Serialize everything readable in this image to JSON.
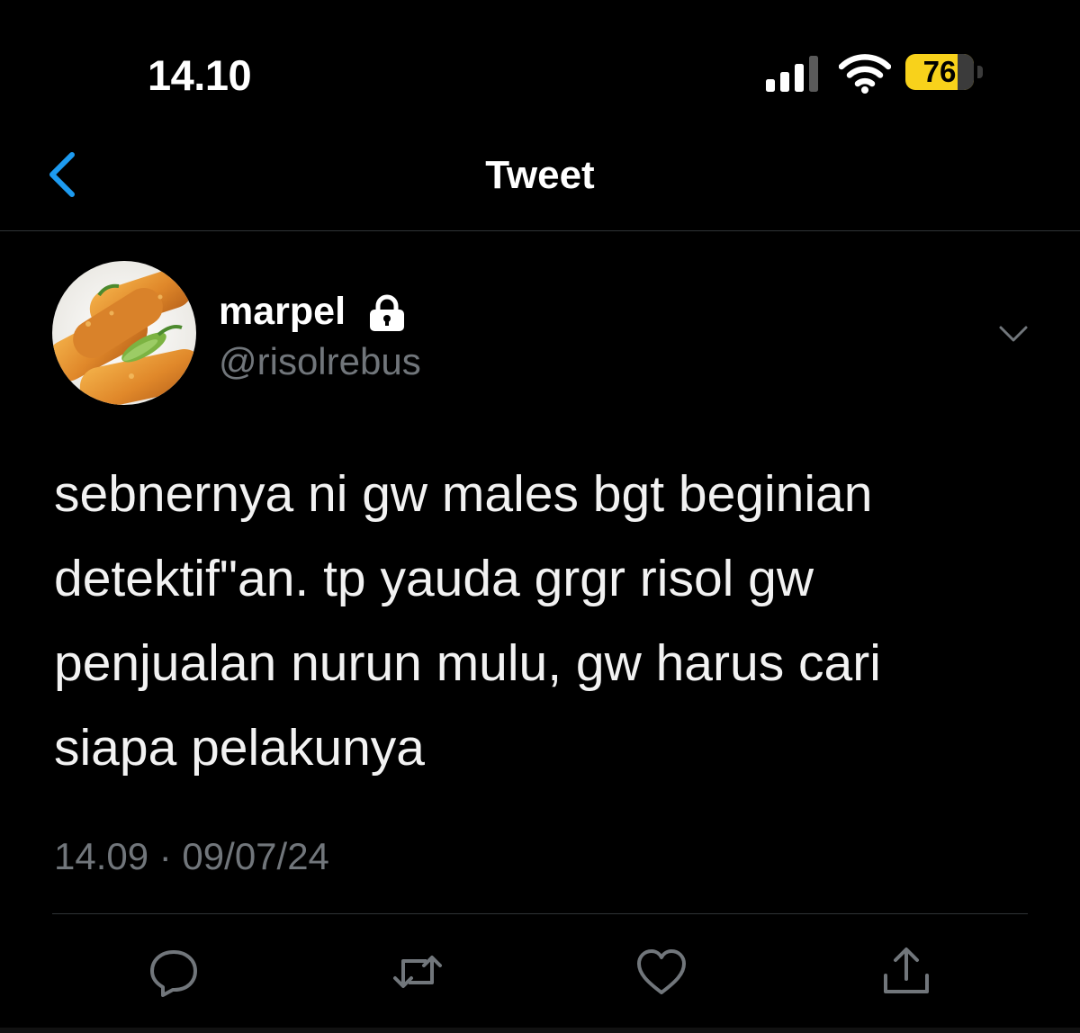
{
  "status_bar": {
    "time": "14.10",
    "battery_level": "76",
    "battery_fraction": 0.76,
    "signal_bars_active": 3,
    "signal_bars_total": 4,
    "icons": [
      "cellular-signal-icon",
      "wifi-icon",
      "battery-icon"
    ]
  },
  "nav": {
    "title": "Tweet",
    "back_icon": "chevron-left-icon"
  },
  "tweet": {
    "author": {
      "display_name": "marpel",
      "handle": "@risolrebus",
      "protected_icon": "lock-icon"
    },
    "more_icon": "chevron-down-icon",
    "lines": [
      "sebnernya ni gw males bgt beginian",
      "detektif\"an. tp yauda grgr risol gw",
      "penjualan nurun mulu, gw harus cari",
      "siapa pelakunya"
    ],
    "timestamp": "14.09 · 09/07/24"
  },
  "actions": [
    {
      "icon": "reply-icon"
    },
    {
      "icon": "retweet-icon"
    },
    {
      "icon": "like-icon"
    },
    {
      "icon": "share-icon"
    }
  ],
  "colors": {
    "background": "#000000",
    "text_primary": "#ffffff",
    "text_secondary": "#71767b",
    "accent": "#1d9bf0",
    "battery": "#f8d21b",
    "divider": "#2f3336"
  }
}
